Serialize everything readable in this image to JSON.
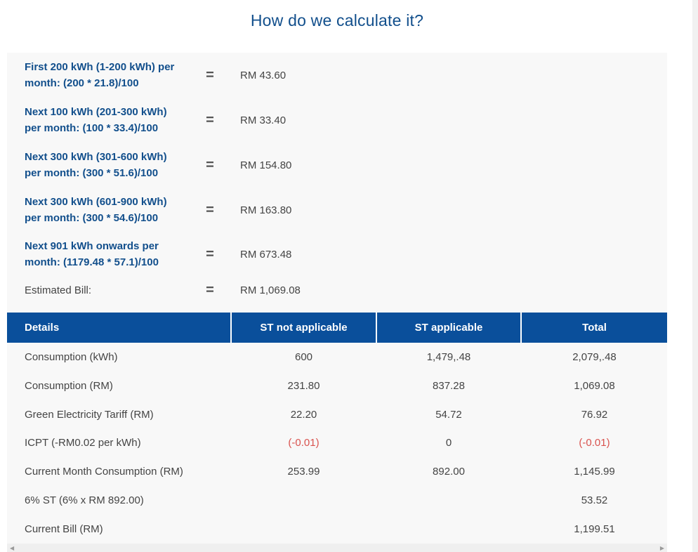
{
  "title": "How do we calculate it?",
  "calc_rows": [
    {
      "label_line1": "First 200 kWh (1-200 kWh) per",
      "label_line2": "month: (200 * 21.8)/100",
      "eq": "=",
      "value": "RM 43.60"
    },
    {
      "label_line1": "Next 100 kWh (201-300 kWh)",
      "label_line2": "per month: (100 * 33.4)/100",
      "eq": "=",
      "value": "RM 33.40"
    },
    {
      "label_line1": "Next 300 kWh (301-600 kWh)",
      "label_line2": "per month: (300 * 51.6)/100",
      "eq": "=",
      "value": "RM 154.80"
    },
    {
      "label_line1": "Next 300 kWh (601-900 kWh)",
      "label_line2": "per month: (300 * 54.6)/100",
      "eq": "=",
      "value": "RM 163.80"
    },
    {
      "label_line1": "Next 901 kWh onwards per",
      "label_line2": "month: (1179.48 * 57.1)/100",
      "eq": "=",
      "value": "RM 673.48"
    }
  ],
  "estimated": {
    "label": "Estimated Bill:",
    "eq": "=",
    "value": "RM 1,069.08"
  },
  "table": {
    "headers": [
      "Details",
      "ST not applicable",
      "ST applicable",
      "Total"
    ],
    "rows": [
      [
        "Consumption (kWh)",
        "600",
        "1,479,.48",
        "2,079,.48"
      ],
      [
        "Consumption (RM)",
        "231.80",
        "837.28",
        "1,069.08"
      ],
      [
        "Green Electricity Tariff (RM)",
        "22.20",
        "54.72",
        "76.92"
      ],
      [
        "ICPT (-RM0.02 per kWh)",
        "(-0.01)",
        "0",
        "(-0.01)"
      ],
      [
        "Current Month Consumption (RM)",
        "253.99",
        "892.00",
        "1,145.99"
      ],
      [
        "6% ST (6% x RM 892.00)",
        "",
        "",
        "53.52"
      ],
      [
        "Current Bill (RM)",
        "",
        "",
        "1,199.51"
      ]
    ]
  },
  "colors": {
    "header_bg": "#0a4f9b",
    "title": "#124f8c",
    "negative": "#d9534f"
  }
}
